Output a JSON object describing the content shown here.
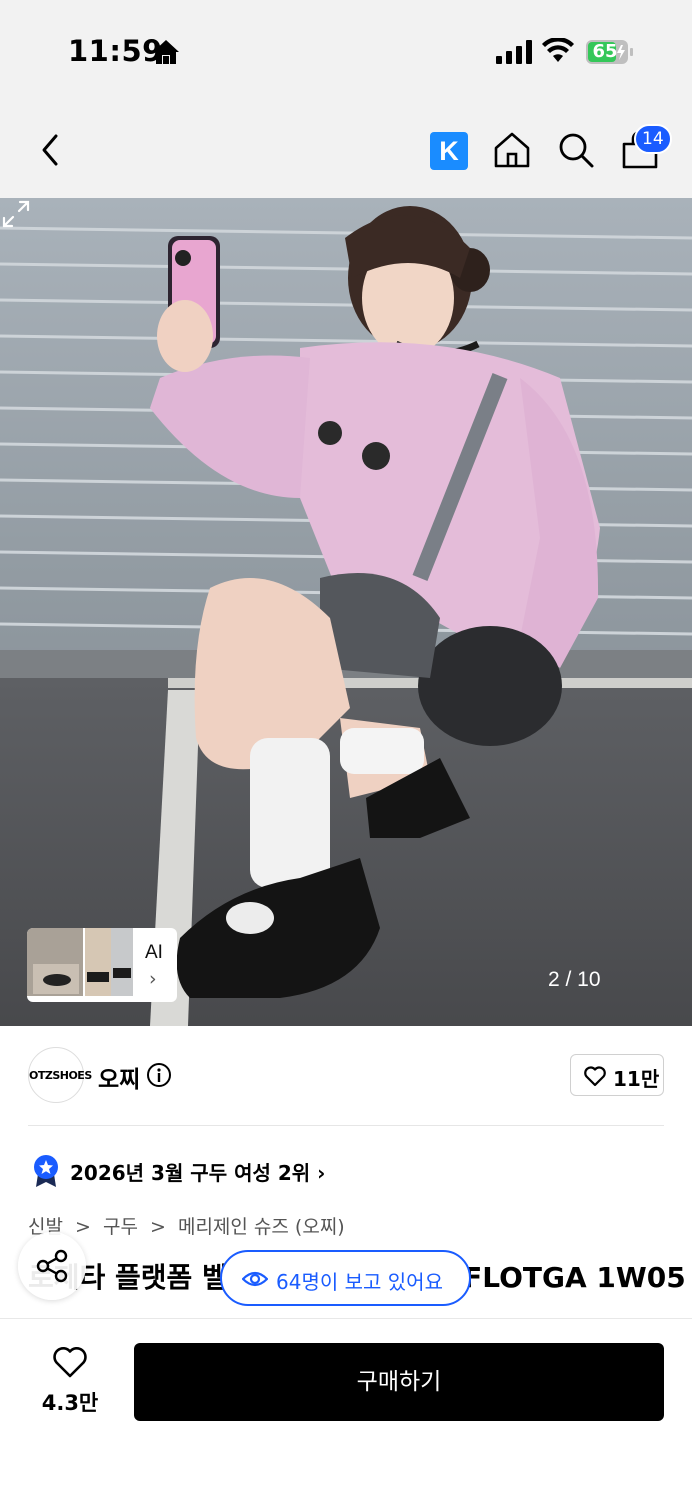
{
  "status_bar": {
    "time": "11:59",
    "battery": "65"
  },
  "header": {
    "kakao_label": "K",
    "cart_count": "14"
  },
  "hero": {
    "page_indicator": "2 / 10",
    "ai_label": "AI",
    "ai_chevron": "›"
  },
  "brand": {
    "logo_text": "OTZSHOES",
    "name": "오찌",
    "wish_count": "11만"
  },
  "ranking": {
    "text": "2026년 3월 구두 여성 2위 ›"
  },
  "breadcrumb": {
    "items": [
      "신발",
      ">",
      "구두",
      ">",
      "메리제인 슈즈 (오찌)"
    ]
  },
  "product": {
    "title": "로제타 플랫폼 벨크로 메리제인 블랙 FLOTGA 1W05"
  },
  "viewers": {
    "text": "64명이 보고 있어요"
  },
  "bottom_bar": {
    "like_count": "4.3만",
    "buy_label": "구매하기"
  },
  "colors": {
    "accent": "#1a5cff",
    "kakao": "#1a8cff",
    "battery": "#34c759"
  }
}
